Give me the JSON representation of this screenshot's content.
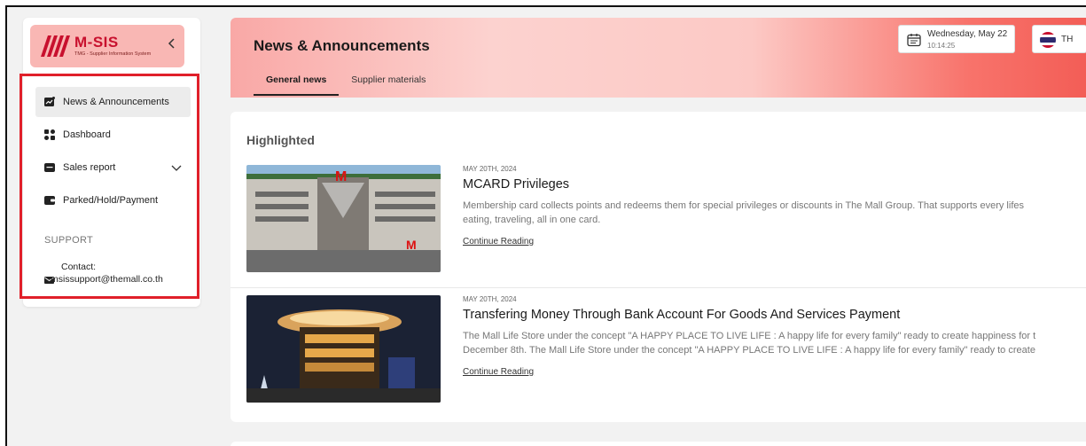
{
  "brand": {
    "name": "M-SIS",
    "subtitle": "TMG - Supplier Information System",
    "logo_icon": "mall-stripes-logo",
    "collapse_icon": "chevron-left-icon"
  },
  "sidebar": {
    "items": [
      {
        "label": "News & Announcements",
        "icon": "news-icon",
        "active": true
      },
      {
        "label": "Dashboard",
        "icon": "dashboard-grid-icon",
        "active": false
      },
      {
        "label": "Sales report",
        "icon": "report-icon",
        "active": false,
        "expandable": true
      },
      {
        "label": "Parked/Hold/Payment",
        "icon": "wallet-icon",
        "active": false
      }
    ],
    "support_title": "SUPPORT",
    "contact_label": "Contact:",
    "contact_email": "msissupport@themall.co.th"
  },
  "header": {
    "title": "News & Announcements",
    "tabs": [
      {
        "label": "General news",
        "active": true
      },
      {
        "label": "Supplier materials",
        "active": false
      }
    ],
    "date": "Wednesday, May 22",
    "time": "10:14:25",
    "language": "TH"
  },
  "content": {
    "section_title": "Highlighted",
    "articles": [
      {
        "date": "MAY 20TH, 2024",
        "title": "MCARD Privileges",
        "desc_line1": "Membership card collects points and redeems them for special privileges or discounts in The Mall Group. That supports every lifes",
        "desc_line2": "eating, traveling, all in one card.",
        "link": "Continue Reading"
      },
      {
        "date": "MAY 20TH, 2024",
        "title": "Transfering Money Through Bank Account For Goods And Services Payment",
        "desc_line1": "The Mall Life Store under the concept \"A HAPPY PLACE TO LIVE LIFE : A happy life for every family\" ready to create happiness for t",
        "desc_line2": "December 8th. The Mall Life Store under the concept \"A HAPPY PLACE TO LIVE LIFE : A happy life for every family\" ready to create",
        "link": "Continue Reading"
      }
    ]
  },
  "colors": {
    "accent": "#c8102e",
    "highlight_border": "#e0202a",
    "header_gradient_start": "#f9a8a6",
    "header_gradient_end": "#f25b54"
  }
}
